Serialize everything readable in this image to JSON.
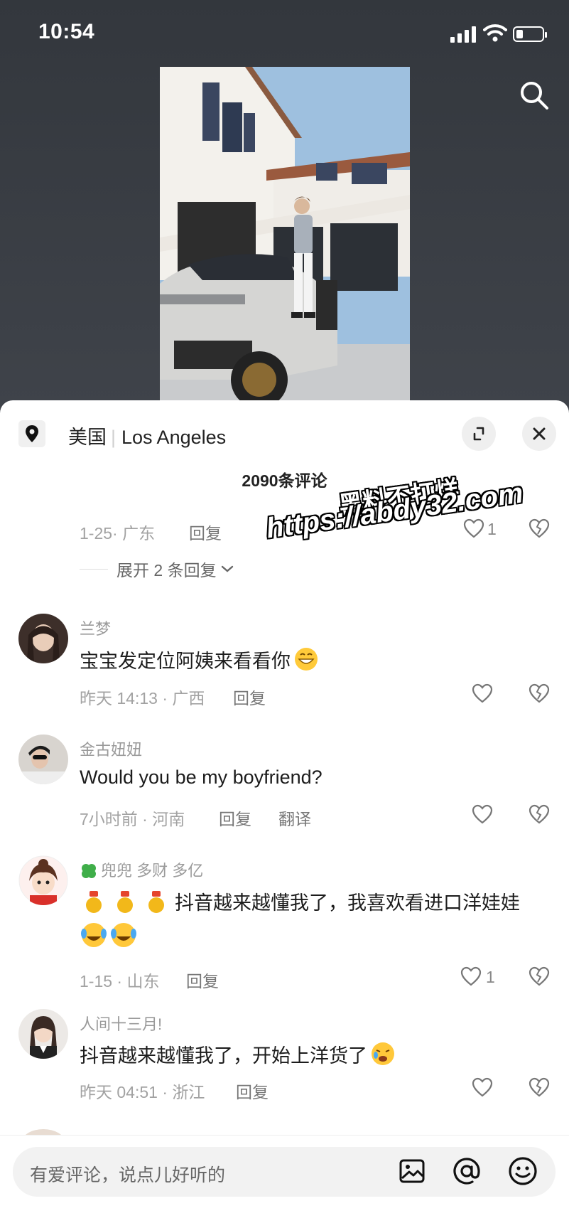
{
  "status_bar": {
    "time": "10:54"
  },
  "location_bar": {
    "country": "美国",
    "city": "Los Angeles"
  },
  "comment_count": "2090条评论",
  "watermark": {
    "line1": "黑料不打烊",
    "line2": "https://abdy32.com"
  },
  "partial_comment": {
    "meta": "1-25· 广东",
    "reply": "回复",
    "likes": "1",
    "expand": "展开 2 条回复"
  },
  "comments": [
    {
      "name": "兰梦",
      "text": "宝宝发定位阿姨来看看你",
      "emoji": "grinning-emoji",
      "meta": "昨天 14:13 · 广西",
      "reply": "回复",
      "likes": ""
    },
    {
      "name": "金古妞妞",
      "text": "Would you be my boyfriend?",
      "meta": "7小时前 · 河南",
      "reply": "回复",
      "translate": "翻译",
      "likes": ""
    },
    {
      "name": "兜兜 多财 多亿",
      "text": "抖音越来越懂我了，我喜欢看进口洋娃娃",
      "emoji": "tears-of-joy-emoji",
      "meta": "1-15 · 山东",
      "reply": "回复",
      "likes": "1"
    },
    {
      "name": "人间十三月!",
      "text": "抖音越来越懂我了，开始上洋货了",
      "emoji": "hot-face-emoji",
      "meta": "昨天 04:51 · 浙江",
      "reply": "回复",
      "likes": ""
    }
  ],
  "input": {
    "placeholder": "有爱评论，说点儿好听的"
  },
  "icons": [
    "location-pin-icon",
    "expand-icon",
    "close-icon",
    "search-icon",
    "heart-icon",
    "dislike-icon",
    "image-icon",
    "at-icon",
    "emoji-icon"
  ]
}
